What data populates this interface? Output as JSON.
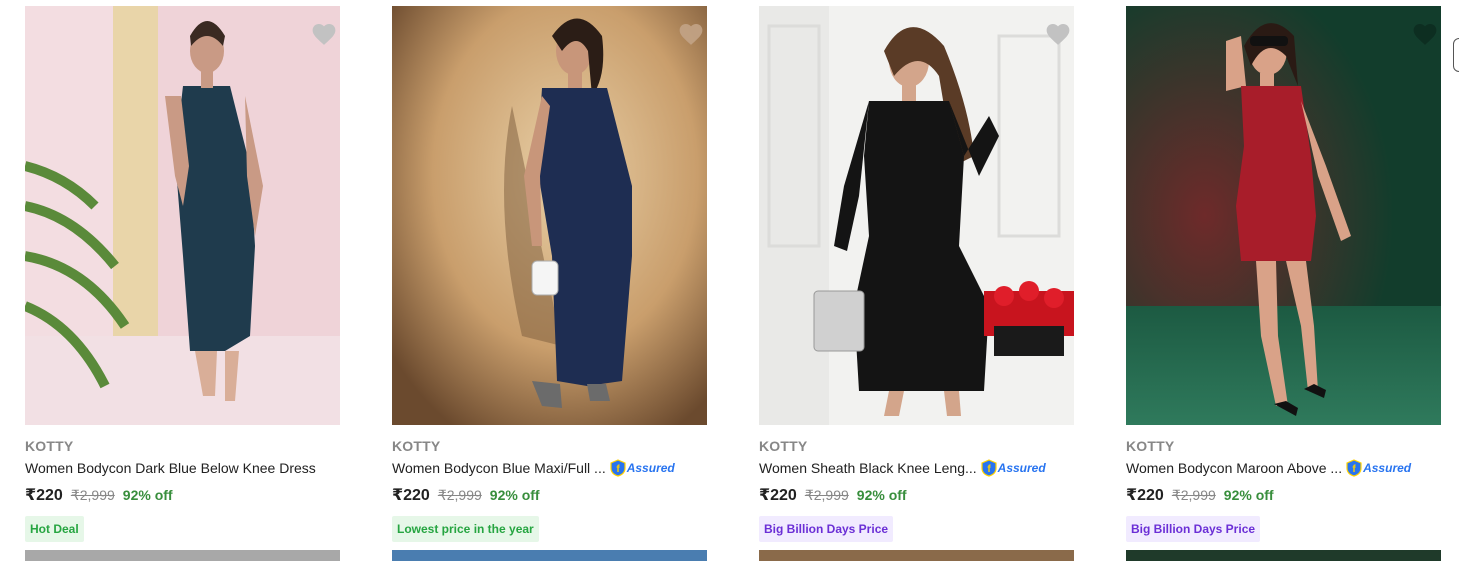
{
  "products": [
    {
      "brand": "KOTTY",
      "title": "Women Bodycon Dark Blue Below Knee Dress",
      "assured": false,
      "price": "₹220",
      "mrp": "₹2,999",
      "discount": "92% off",
      "badge": "Hot Deal",
      "badge_style": "green",
      "wishlist_icon": "heart-icon"
    },
    {
      "brand": "KOTTY",
      "title": "Women Bodycon Blue Maxi/Full ...",
      "assured": true,
      "price": "₹220",
      "mrp": "₹2,999",
      "discount": "92% off",
      "badge": "Lowest price in the year",
      "badge_style": "green",
      "wishlist_icon": "heart-icon"
    },
    {
      "brand": "KOTTY",
      "title": "Women Sheath Black Knee Leng...",
      "assured": true,
      "price": "₹220",
      "mrp": "₹2,999",
      "discount": "92% off",
      "badge": "Big Billion Days Price",
      "badge_style": "purple",
      "wishlist_icon": "heart-icon"
    },
    {
      "brand": "KOTTY",
      "title": "Women Bodycon Maroon Above ...",
      "assured": true,
      "price": "₹220",
      "mrp": "₹2,999",
      "discount": "92% off",
      "badge": "Big Billion Days Price",
      "badge_style": "purple",
      "wishlist_icon": "heart-icon"
    }
  ],
  "assured_label": "Assured",
  "colors": {
    "discount_green": "#388e3c",
    "assured_blue": "#2874f0",
    "badge_green_bg": "#e6f7e8",
    "badge_purple_bg": "#f1ebff"
  }
}
